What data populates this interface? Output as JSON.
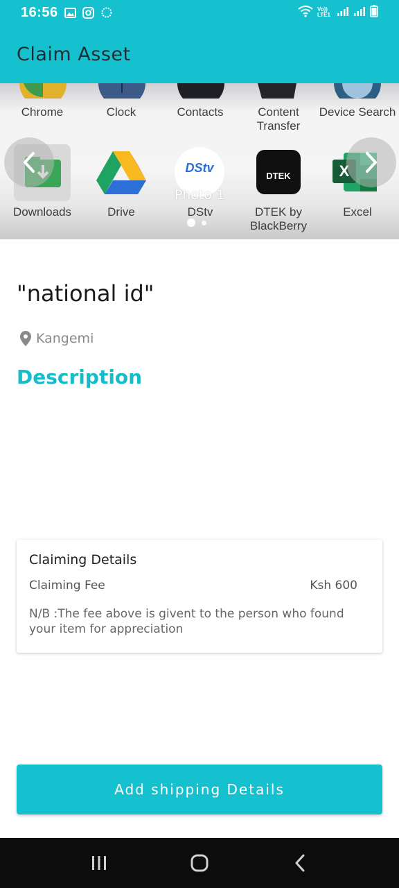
{
  "status_bar": {
    "time": "16:56",
    "icons": [
      "image-icon",
      "instagram-icon",
      "sync-icon",
      "wifi-icon",
      "volte-icon",
      "signal-icon",
      "signal-icon",
      "battery-icon"
    ],
    "volte_label": "Vo)) LTE1"
  },
  "app_bar": {
    "title": "Claim Asset"
  },
  "carousel": {
    "photo_label": "Photo 1",
    "current_index": 0,
    "total": 2,
    "top_row": [
      "Chrome",
      "Clock",
      "Contacts",
      "Content Transfer",
      "Device Search"
    ],
    "bottom_row": [
      "Downloads",
      "Drive",
      "DStv",
      "DTEK by BlackBerry",
      "Excel"
    ],
    "dstv_logo_text": "DStv",
    "dtek_logo_text": "DTEK",
    "excel_logo_text": "X"
  },
  "asset": {
    "title": "\"national id\"",
    "location": "Kangemi",
    "description_heading": "Description",
    "description": ""
  },
  "claiming": {
    "title": "Claiming Details",
    "fee_label": "Claiming Fee",
    "fee_value": "Ksh 600",
    "note": "N/B :The fee above is givent to the person who found your item for appreciation"
  },
  "actions": {
    "shipping_button": "Add shipping Details"
  },
  "colors": {
    "accent": "#16c1cf",
    "title_text": "#1c2e33",
    "nav_bar": "#0c0c0c"
  }
}
